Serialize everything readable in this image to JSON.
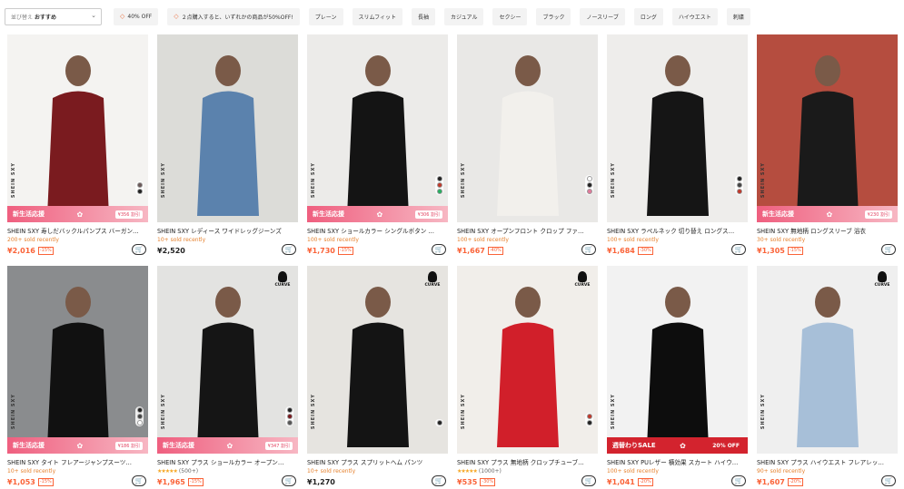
{
  "filters": {
    "sort_label": "並び替え",
    "sort_value": "おすすめ",
    "chips": [
      {
        "label": "40% OFF",
        "tag": true
      },
      {
        "label": "２点購入すると、いずれかの商品が50%OFF!",
        "tag": true
      },
      {
        "label": "プレーン",
        "tag": false
      },
      {
        "label": "スリムフィット",
        "tag": false
      },
      {
        "label": "長袖",
        "tag": false
      },
      {
        "label": "カジュアル",
        "tag": false
      },
      {
        "label": "セクシー",
        "tag": false
      },
      {
        "label": "ブラック",
        "tag": false
      },
      {
        "label": "ノースリーブ",
        "tag": false
      },
      {
        "label": "ロング",
        "tag": false
      },
      {
        "label": "ハイウエスト",
        "tag": false
      },
      {
        "label": "刺繍",
        "tag": false
      }
    ]
  },
  "brand_vertical": "SHEIN SXY",
  "curve_label": "CURVE",
  "promo_new": "新生活応援",
  "promo_sale": "週替わりSALE",
  "products": [
    {
      "title": "SHEIN SXY 寿しだバックルパンプス バーガン…",
      "sold": "200+ sold recently",
      "price": "¥2,016",
      "discount": "-15%",
      "promo": "new",
      "promo_right": "¥356 割引",
      "swatches": [
        "#6b5a5a",
        "#222222"
      ],
      "curve": false,
      "rating": "",
      "bg": "#f4f3f1",
      "fig": "#7a1b1f"
    },
    {
      "title": "SHEIN SXY レディース ワイドレッグジーンズ",
      "sold": "10+ sold recently",
      "price": "¥2,520",
      "discount": "",
      "promo": "none",
      "promo_right": "",
      "swatches": [],
      "curve": false,
      "rating": "",
      "bg": "#dcdcd8",
      "fig": "#5b82ad"
    },
    {
      "title": "SHEIN SXY ショールカラー シングルボタン …",
      "sold": "100+ sold recently",
      "price": "¥1,730",
      "discount": "-15%",
      "promo": "new",
      "promo_right": "¥306 割引",
      "swatches": [
        "#222222",
        "#c0392b",
        "#27ae60"
      ],
      "curve": false,
      "rating": "",
      "bg": "#ecebe9",
      "fig": "#141414"
    },
    {
      "title": "SHEIN SXY オープンフロント クロップ ファ…",
      "sold": "100+ sold recently",
      "price": "¥1,667",
      "discount": "-40%",
      "promo": "none",
      "promo_right": "",
      "swatches": [
        "#ffffff",
        "#222222",
        "#e07a9a"
      ],
      "curve": false,
      "rating": "",
      "bg": "#e9e8e6",
      "fig": "#f2f0ec"
    },
    {
      "title": "SHEIN SXY ラペルネック 切り替え ロングス…",
      "sold": "100+ sold recently",
      "price": "¥1,684",
      "discount": "-30%",
      "promo": "none",
      "promo_right": "",
      "swatches": [
        "#222222",
        "#444444",
        "#c0392b"
      ],
      "curve": false,
      "rating": "",
      "bg": "#eeedeb",
      "fig": "#151515"
    },
    {
      "title": "SHEIN SXY 無地柄 ロングスリーブ 浴衣",
      "sold": "30+ sold recently",
      "price": "¥1,305",
      "discount": "-15%",
      "promo": "new",
      "promo_right": "¥230 割引",
      "swatches": [],
      "curve": false,
      "rating": "",
      "bg": "#b54d3f",
      "fig": "#1a1a1a"
    },
    {
      "title": "SHEIN SXY タイト フレアージャンプスーツ…",
      "sold": "10+ sold recently",
      "price": "¥1,053",
      "discount": "-15%",
      "promo": "new",
      "promo_right": "¥186 割引",
      "swatches": [
        "#222222",
        "#444444",
        "#ffffff"
      ],
      "curve": false,
      "rating": "",
      "bg": "#8a8c8e",
      "fig": "#111111"
    },
    {
      "title": "SHEIN SXY プラス ショールカラー オープン…",
      "sold": "",
      "price": "¥1,965",
      "discount": "-15%",
      "promo": "new",
      "promo_right": "¥347 割引",
      "swatches": [
        "#222222",
        "#7a1b1f",
        "#555555"
      ],
      "curve": true,
      "rating": "(500+)",
      "bg": "#e3e3e1",
      "fig": "#151515"
    },
    {
      "title": "SHEIN SXY プラス スプリットヘム パンツ",
      "sold": "10+ sold recently",
      "price": "¥1,270",
      "discount": "",
      "promo": "none",
      "promo_right": "",
      "swatches": [
        "#222222"
      ],
      "curve": true,
      "rating": "",
      "bg": "#e6e4e0",
      "fig": "#141414"
    },
    {
      "title": "SHEIN SXY プラス 無地柄 クロップチューブ…",
      "sold": "",
      "price": "¥535",
      "discount": "-30%",
      "promo": "none",
      "promo_right": "",
      "swatches": [
        "#c0392b",
        "#222222"
      ],
      "curve": true,
      "rating": "(1000+)",
      "bg": "#f1eeea",
      "fig": "#d11f2a"
    },
    {
      "title": "SHEIN SXY PUレザー 横効果 スカート ハイウ…",
      "sold": "100+ sold recently",
      "price": "¥1,041",
      "discount": "-20%",
      "promo": "sale",
      "promo_right": "20% OFF",
      "swatches": [],
      "curve": false,
      "rating": "",
      "bg": "#f2f2f2",
      "fig": "#0d0d0d"
    },
    {
      "title": "SHEIN SXY プラス ハイウエスト フレアレッ…",
      "sold": "90+ sold recently",
      "price": "¥1,607",
      "discount": "-20%",
      "promo": "none",
      "promo_right": "",
      "swatches": [],
      "curve": true,
      "rating": "",
      "bg": "#efefef",
      "fig": "#a7bfd8"
    }
  ],
  "icons": {
    "sort_chevron": "chevron-down-icon",
    "chip_tag": "tag-icon",
    "cart": "add-to-cart-icon"
  },
  "colors": {
    "price": "#fa6338",
    "sold": "#e5812d",
    "promo_pink": "#ef5f7f",
    "sale_red": "#d3232e"
  }
}
